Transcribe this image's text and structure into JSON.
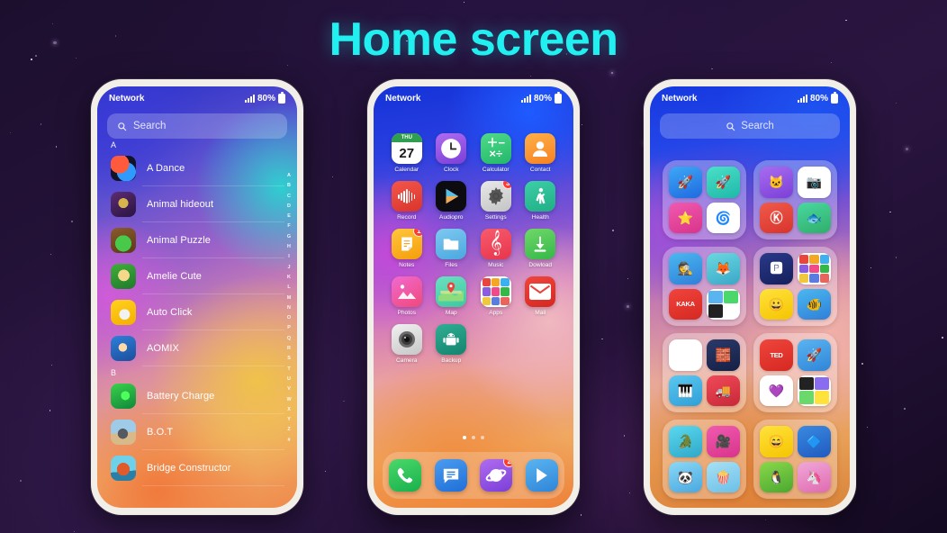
{
  "title": "Home screen",
  "theme": {
    "title_color": "#22f0f0",
    "badge_color": "#ff3b30",
    "bezel_color": "#f2efe9"
  },
  "status_bar": {
    "carrier": "Network",
    "battery_text": "80%",
    "signal_icon": "signal-bars-icon",
    "battery_icon": "battery-icon"
  },
  "phone1": {
    "search": {
      "placeholder": "Search",
      "icon": "search-icon"
    },
    "sections": [
      {
        "letter": "A",
        "apps": [
          {
            "name": "A Dance"
          },
          {
            "name": "Animal hideout"
          },
          {
            "name": "Animal Puzzle"
          },
          {
            "name": "Amelie Cute"
          },
          {
            "name": "Auto Click"
          },
          {
            "name": "AOMIX"
          }
        ]
      },
      {
        "letter": "B",
        "apps": [
          {
            "name": "Battery Charge"
          },
          {
            "name": "B.O.T"
          },
          {
            "name": "Bridge Constructor"
          }
        ]
      }
    ],
    "alpha_index": [
      "A",
      "B",
      "C",
      "D",
      "E",
      "F",
      "G",
      "H",
      "I",
      "J",
      "K",
      "L",
      "M",
      "N",
      "O",
      "P",
      "Q",
      "R",
      "S",
      "T",
      "U",
      "V",
      "W",
      "X",
      "Y",
      "Z",
      "#"
    ]
  },
  "phone2": {
    "apps": [
      {
        "name": "Calendar",
        "icon": "calendar-icon",
        "badge": null,
        "day": "27",
        "weekday": "THU"
      },
      {
        "name": "Clock",
        "icon": "clock-icon",
        "badge": null
      },
      {
        "name": "Calculator",
        "icon": "calculator-icon",
        "badge": null
      },
      {
        "name": "Contact",
        "icon": "contact-icon",
        "badge": null
      },
      {
        "name": "Record",
        "icon": "record-icon",
        "badge": null
      },
      {
        "name": "Audiopro",
        "icon": "audiopro-icon",
        "badge": null
      },
      {
        "name": "Settings",
        "icon": "settings-icon",
        "badge": "3"
      },
      {
        "name": "Health",
        "icon": "health-icon",
        "badge": null
      },
      {
        "name": "Notes",
        "icon": "notes-icon",
        "badge": "1"
      },
      {
        "name": "Files",
        "icon": "files-icon",
        "badge": null
      },
      {
        "name": "Music",
        "icon": "music-icon",
        "badge": null
      },
      {
        "name": "Dowload",
        "icon": "download-icon",
        "badge": null
      },
      {
        "name": "Photos",
        "icon": "photos-icon",
        "badge": null
      },
      {
        "name": "Map",
        "icon": "map-icon",
        "badge": null
      },
      {
        "name": "Apps",
        "icon": "apps-folder-icon",
        "badge": null
      },
      {
        "name": "Mail",
        "icon": "mail-icon",
        "badge": null
      },
      {
        "name": "Camera",
        "icon": "camera-icon",
        "badge": null
      },
      {
        "name": "Backup",
        "icon": "backup-icon",
        "badge": null
      }
    ],
    "page_dots": {
      "count": 3,
      "active_index": 0
    },
    "dock": [
      {
        "name": "Phone",
        "icon": "phone-icon",
        "badge": null
      },
      {
        "name": "Messages",
        "icon": "messages-icon",
        "badge": null
      },
      {
        "name": "Browser",
        "icon": "browser-icon",
        "badge": "2"
      },
      {
        "name": "Play Store",
        "icon": "play-store-icon",
        "badge": null
      }
    ]
  },
  "phone3": {
    "search": {
      "placeholder": "Search",
      "icon": "search-icon"
    },
    "folders": [
      {
        "name": "folder-1",
        "apps": [
          {
            "icon": "rocket-blue-icon"
          },
          {
            "icon": "rocket-teal-icon"
          },
          {
            "icon": "star-pink-icon"
          },
          {
            "icon": "spiral-blue-icon"
          }
        ]
      },
      {
        "name": "folder-2",
        "apps": [
          {
            "icon": "cat-purple-icon"
          },
          {
            "icon": "camera-color-icon"
          },
          {
            "icon": "kinemaster-icon"
          },
          {
            "icon": "fish-green-icon"
          }
        ]
      },
      {
        "name": "folder-3",
        "apps": [
          {
            "icon": "detective-icon"
          },
          {
            "icon": "fox-brush-icon"
          },
          {
            "icon": "kaka-icon"
          },
          {
            "icon": "mini-apps-icon"
          }
        ]
      },
      {
        "name": "folder-4",
        "apps": [
          {
            "icon": "p-navy-icon"
          },
          {
            "icon": "grid-colors-icon"
          },
          {
            "icon": "smiley-yellow-icon"
          },
          {
            "icon": "songs-fish-icon"
          }
        ]
      },
      {
        "name": "folder-5",
        "apps": [
          {
            "icon": "m-rainbow-icon"
          },
          {
            "icon": "tetris-icon"
          },
          {
            "icon": "piano-kids-icon"
          },
          {
            "icon": "monster-truck-icon"
          }
        ]
      },
      {
        "name": "folder-6",
        "apps": [
          {
            "icon": "ted-icon",
            "label": "TED"
          },
          {
            "icon": "rocket-white-icon"
          },
          {
            "icon": "heart-purple-icon"
          },
          {
            "icon": "mini-apps-2-icon"
          }
        ]
      },
      {
        "name": "folder-7",
        "apps": [
          {
            "icon": "crocodile-icon"
          },
          {
            "icon": "video-pink-icon"
          },
          {
            "icon": "panda-blue-icon"
          },
          {
            "icon": "popcorn-icon"
          }
        ]
      },
      {
        "name": "folder-8",
        "apps": [
          {
            "icon": "emoji-yellow-icon"
          },
          {
            "icon": "blue-shape-icon"
          },
          {
            "icon": "penguin-icon"
          },
          {
            "icon": "unicorn-pink-icon"
          }
        ]
      }
    ]
  }
}
